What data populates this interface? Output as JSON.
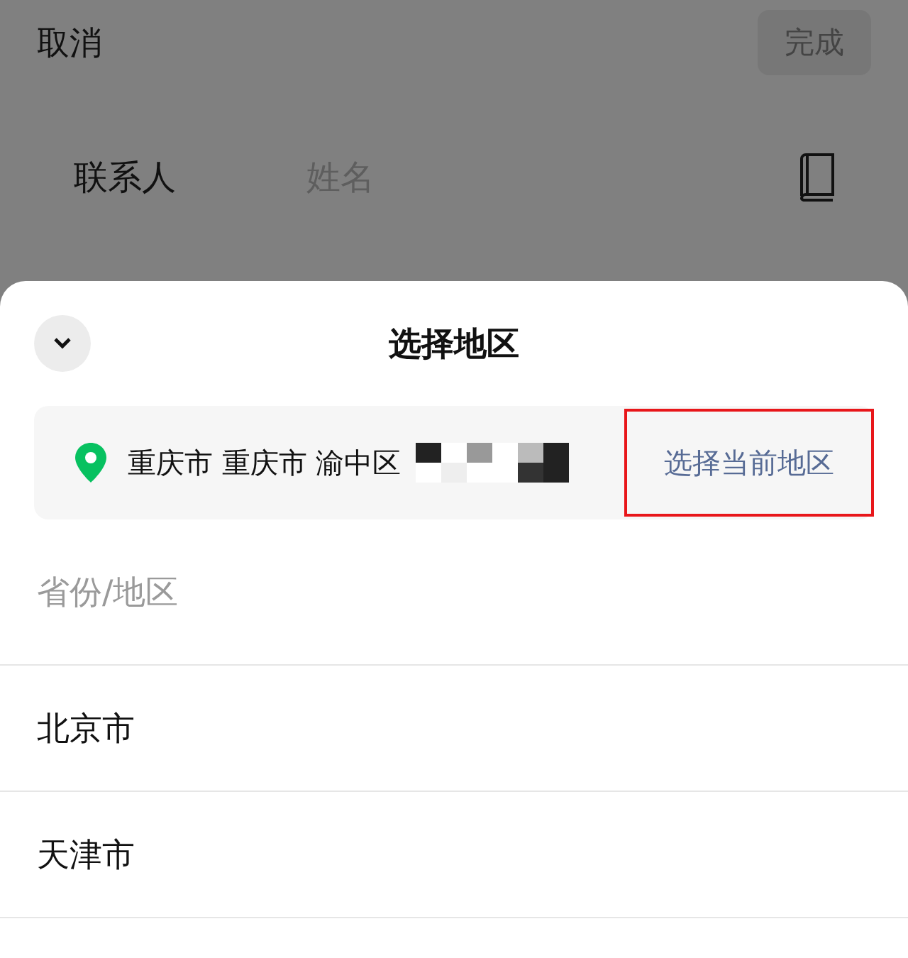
{
  "background_form": {
    "cancel": "取消",
    "done": {
      "label": "完成",
      "disabled": true
    },
    "contact_label": "联系人",
    "name_placeholder": "姓名"
  },
  "sheet": {
    "title": "选择地区",
    "location": {
      "text": "重庆市 重庆市 渝中区",
      "redacted": true,
      "action": "选择当前地区",
      "highlighted": true
    },
    "section_header": "省份/地区",
    "regions": [
      {
        "name": "北京市"
      },
      {
        "name": "天津市"
      }
    ]
  }
}
